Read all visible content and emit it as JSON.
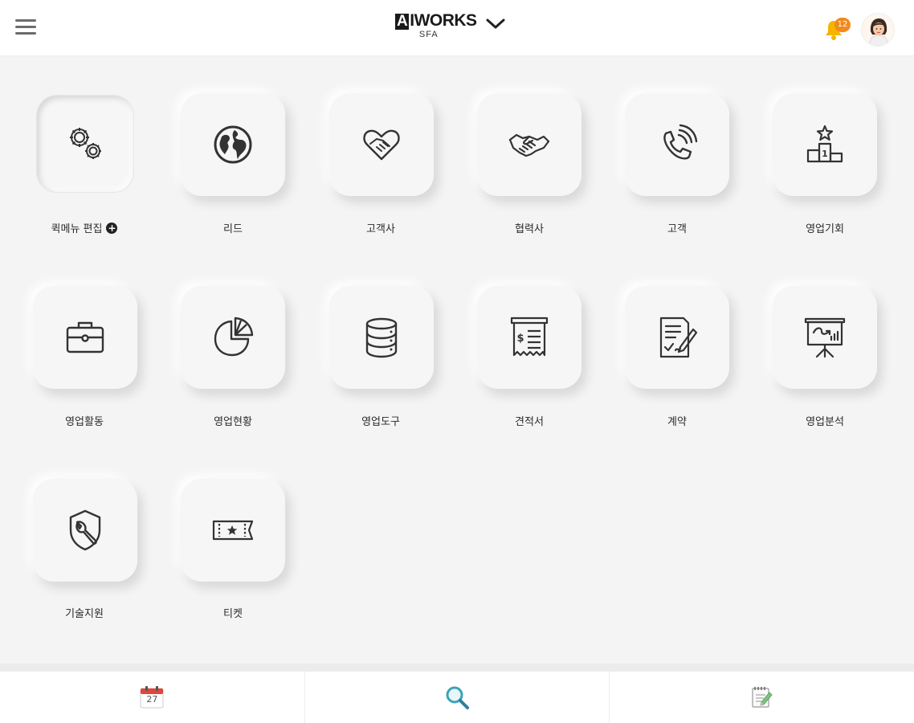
{
  "header": {
    "logo_text": "IWORKS",
    "logo_mark": "A",
    "logo_sub": "SFA",
    "notification_count": "12",
    "icons": {
      "menu": "hamburger-icon",
      "dropdown": "chevron-down-icon",
      "bell": "bell-icon",
      "avatar": "user-avatar"
    },
    "colors": {
      "badge": "#f08a1d",
      "bell": "#f5b400"
    }
  },
  "menu_items": [
    {
      "label": "퀵메뉴 편집",
      "icon": "gears-icon",
      "has_add": true
    },
    {
      "label": "리드",
      "icon": "globe-icon"
    },
    {
      "label": "고객사",
      "icon": "heart-handshake-icon"
    },
    {
      "label": "협력사",
      "icon": "handshake-icon"
    },
    {
      "label": "고객",
      "icon": "phone-call-icon"
    },
    {
      "label": "영업기회",
      "icon": "podium-star-icon"
    },
    {
      "label": "영업활동",
      "icon": "briefcase-icon"
    },
    {
      "label": "영업현황",
      "icon": "pie-chart-icon"
    },
    {
      "label": "영업도구",
      "icon": "database-icon"
    },
    {
      "label": "견적서",
      "icon": "receipt-icon"
    },
    {
      "label": "계약",
      "icon": "contract-icon"
    },
    {
      "label": "영업분석",
      "icon": "presentation-board-icon"
    },
    {
      "label": "기술지원",
      "icon": "shield-wrench-icon"
    },
    {
      "label": "티켓",
      "icon": "ticket-icon"
    }
  ],
  "tabbar": {
    "calendar_day": "27",
    "tabs": [
      "calendar-icon",
      "search-icon",
      "note-edit-icon"
    ],
    "colors": {
      "calendar": "#e0463a",
      "search": "#3aa3b8",
      "note": "#7bc47f"
    }
  }
}
